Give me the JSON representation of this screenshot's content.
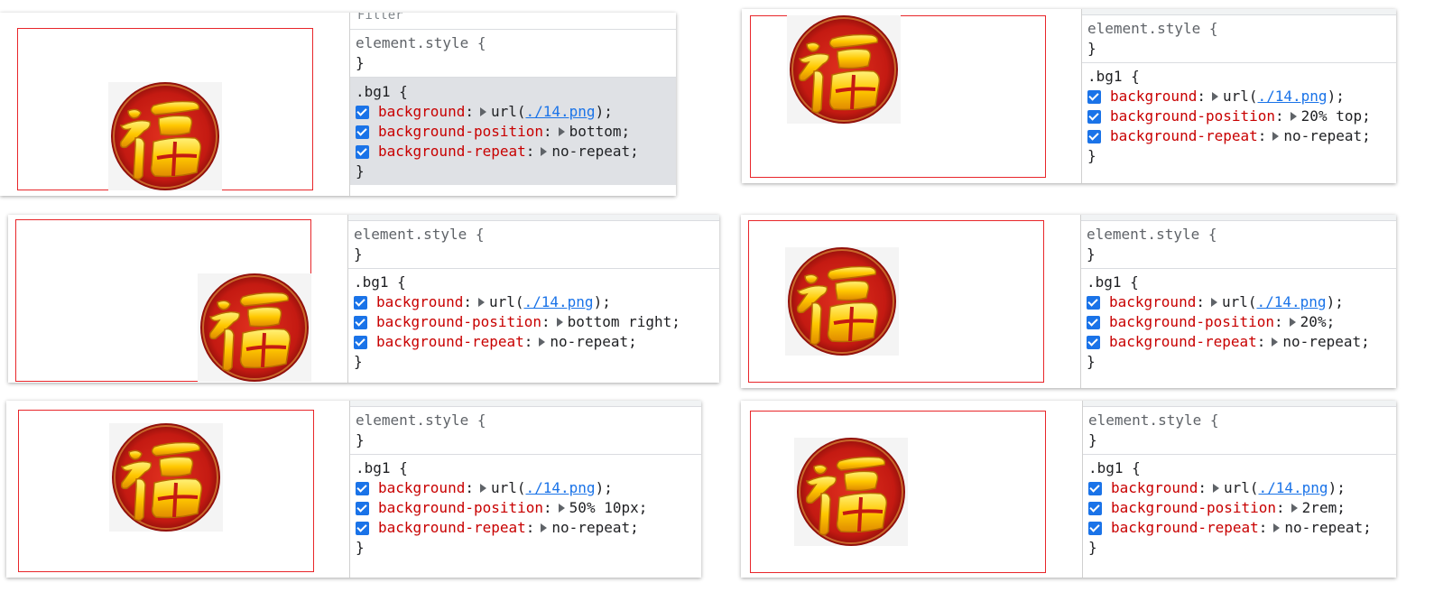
{
  "filter_placeholder": "Filter",
  "common": {
    "element_style_selector": "element.style {",
    "close_brace": "}",
    "rule_selector": ".bg1 {",
    "prop_background": "background",
    "prop_position": "background-position",
    "prop_repeat": "background-repeat",
    "colon": ":",
    "url_open": "url(",
    "url_link": "./14.png",
    "url_close": ");",
    "repeat_value": "no-repeat;"
  },
  "panels": [
    {
      "position_value": "bottom;"
    },
    {
      "position_value": "20% top;"
    },
    {
      "position_value": "bottom right;"
    },
    {
      "position_value": "20%;"
    },
    {
      "position_value": "50% 10px;"
    },
    {
      "position_value": "2rem;"
    }
  ],
  "colors": {
    "red_box": "#e8262a",
    "property": "#c80000",
    "link": "#1a73e8",
    "checkbox": "#1a73e8"
  }
}
